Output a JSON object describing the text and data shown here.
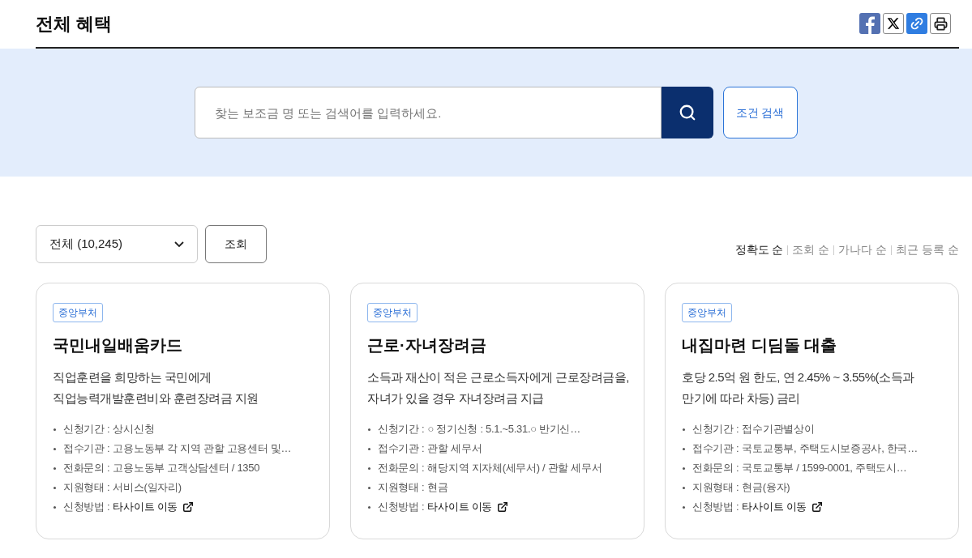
{
  "page_title": "전체 혜택",
  "share_buttons": [
    {
      "kind": "facebook"
    },
    {
      "kind": "x"
    },
    {
      "kind": "link"
    },
    {
      "kind": "print"
    }
  ],
  "search": {
    "placeholder": "찾는 보조금 명 또는 검색어를 입력하세요.",
    "condition_button": "조건 검색"
  },
  "filter": {
    "select_value": "전체 (10,245)",
    "query_button": "조회"
  },
  "sort_options": [
    {
      "label": "정확도 순",
      "selected": true
    },
    {
      "label": "조회 순",
      "selected": false
    },
    {
      "label": "가나다 순",
      "selected": false
    },
    {
      "label": "최근 등록 순",
      "selected": false
    }
  ],
  "cards": [
    {
      "tag": "중앙부처",
      "title": "국민내일배움카드",
      "description": [
        "직업훈련을 희망하는 국민에게",
        "직업능력개발훈련비와 훈련장려금 지원"
      ],
      "info": [
        {
          "kind": "text",
          "label": "신청기간 :",
          "value": "상시신청"
        },
        {
          "kind": "text",
          "label": "접수기관 :",
          "value": "고용노동부 각 지역 관할 고용센터 및…"
        },
        {
          "kind": "text",
          "label": "전화문의 :",
          "value": "고용노동부 고객상담센터 / 1350"
        },
        {
          "kind": "text",
          "label": "지원형태 :",
          "value": "서비스(일자리)"
        },
        {
          "kind": "link",
          "label": "신청방법 :",
          "value": "타사이트 이동"
        }
      ]
    },
    {
      "tag": "중앙부처",
      "title": "근로·자녀장려금",
      "description": [
        "소득과 재산이 적은 근로소득자에게 근로장려금을,",
        "자녀가 있을 경우 자녀장려금 지급"
      ],
      "info": [
        {
          "kind": "text",
          "label": "신청기간 :",
          "value": "○ 정기신청 : 5.1.~5.31.○ 반기신…"
        },
        {
          "kind": "text",
          "label": "접수기관 :",
          "value": "관할 세무서"
        },
        {
          "kind": "text",
          "label": "전화문의 :",
          "value": "해당지역 지자체(세무서) / 관할 세무서"
        },
        {
          "kind": "text",
          "label": "지원형태 :",
          "value": "현금"
        },
        {
          "kind": "link",
          "label": "신청방법 :",
          "value": "타사이트 이동"
        }
      ]
    },
    {
      "tag": "중앙부처",
      "title": "내집마련 디딤돌 대출",
      "description": [
        "호당 2.5억 원 한도, 연 2.45% ~ 3.55%(소득과",
        "만기에 따라 차등) 금리"
      ],
      "info": [
        {
          "kind": "text",
          "label": "신청기간 :",
          "value": "접수기관별상이"
        },
        {
          "kind": "text",
          "label": "접수기관 :",
          "value": "국토교통부, 주택도시보증공사, 한국…"
        },
        {
          "kind": "text",
          "label": "전화문의 :",
          "value": "국토교통부 / 1599-0001, 주택도시…"
        },
        {
          "kind": "text",
          "label": "지원형태 :",
          "value": "현금(융자)"
        },
        {
          "kind": "link",
          "label": "신청방법 :",
          "value": "타사이트 이동"
        }
      ]
    }
  ]
}
